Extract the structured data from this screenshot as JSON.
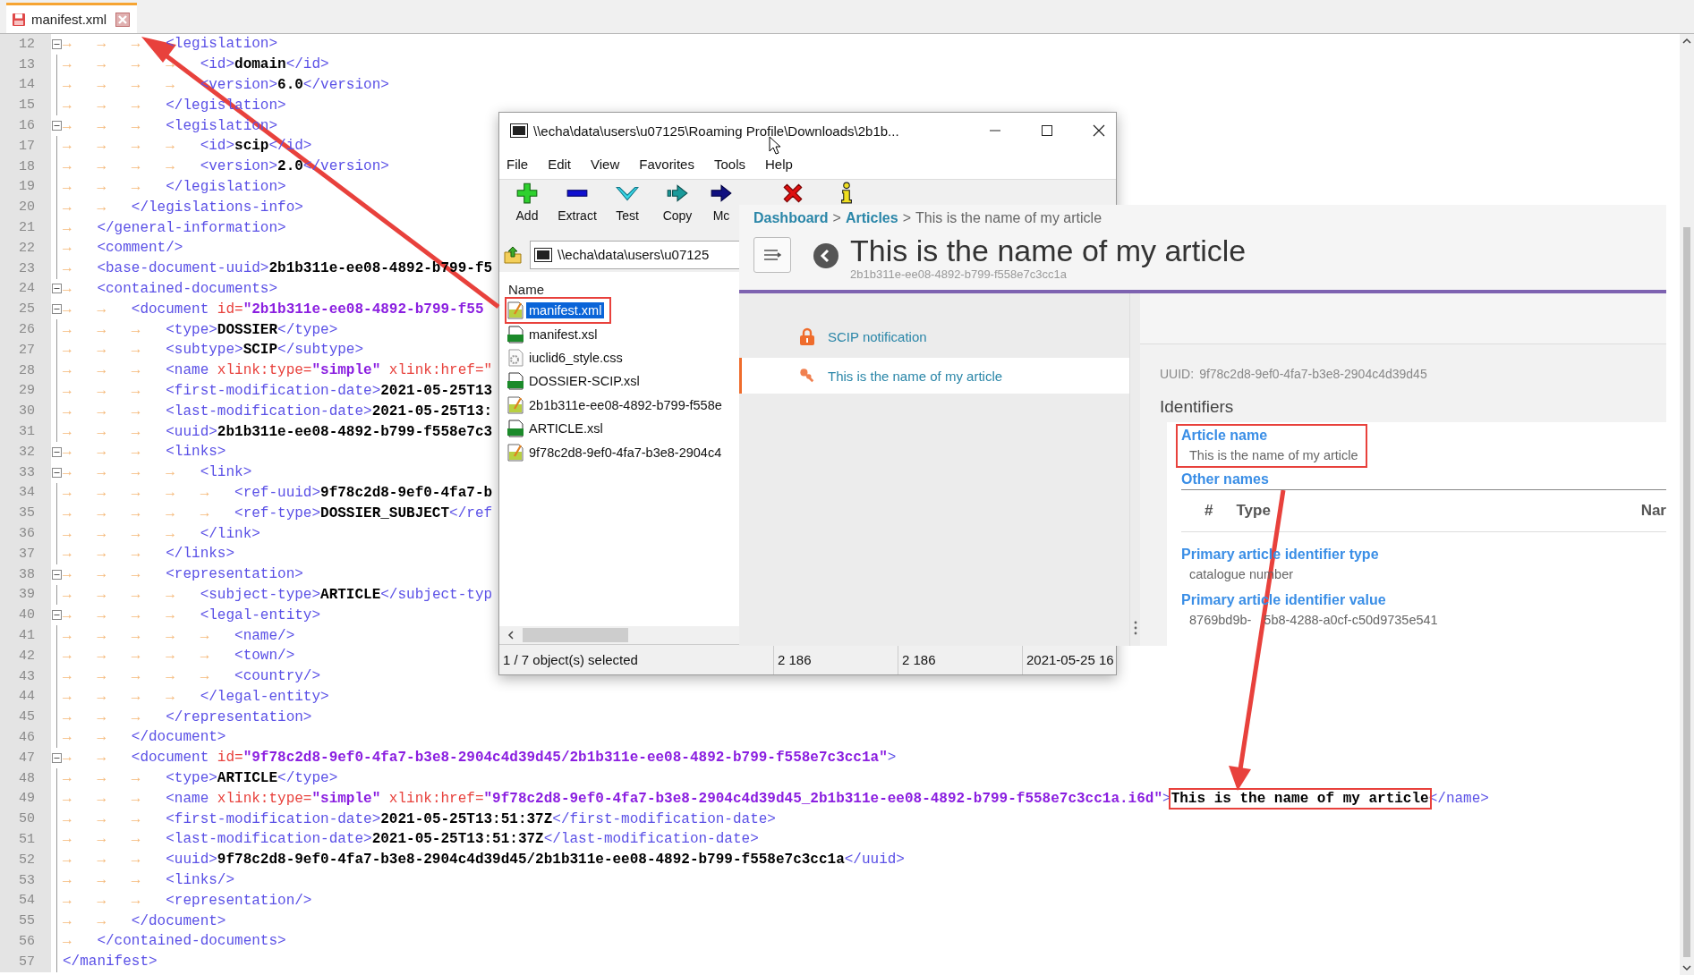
{
  "editor_tab": {
    "title": "manifest.xml",
    "selected": true
  },
  "code_lines": [
    {
      "number": "12",
      "fold_marker": true,
      "tokens": [
        {
          "kind": "tabs",
          "text": "→   →   →   "
        },
        {
          "kind": "tag",
          "text": "<legislation>"
        }
      ]
    },
    {
      "number": "13",
      "fold_marker": false,
      "tokens": [
        {
          "kind": "tabs",
          "text": "→   →   →   →   "
        },
        {
          "kind": "tag",
          "text": "<id>"
        },
        {
          "kind": "text",
          "text": "domain"
        },
        {
          "kind": "tag",
          "text": "</id>"
        }
      ]
    },
    {
      "number": "14",
      "fold_marker": false,
      "tokens": [
        {
          "kind": "tabs",
          "text": "→   →   →   →   "
        },
        {
          "kind": "tag",
          "text": "<version>"
        },
        {
          "kind": "text",
          "text": "6.0"
        },
        {
          "kind": "tag",
          "text": "</version>"
        }
      ]
    },
    {
      "number": "15",
      "fold_marker": false,
      "tokens": [
        {
          "kind": "tabs",
          "text": "→   →   →   "
        },
        {
          "kind": "tag",
          "text": "</legislation>"
        }
      ]
    },
    {
      "number": "16",
      "fold_marker": true,
      "tokens": [
        {
          "kind": "tabs",
          "text": "→   →   →   "
        },
        {
          "kind": "tag",
          "text": "<legislation>"
        }
      ]
    },
    {
      "number": "17",
      "fold_marker": false,
      "tokens": [
        {
          "kind": "tabs",
          "text": "→   →   →   →   "
        },
        {
          "kind": "tag",
          "text": "<id>"
        },
        {
          "kind": "text",
          "text": "scip"
        },
        {
          "kind": "tag",
          "text": "</id>"
        }
      ]
    },
    {
      "number": "18",
      "fold_marker": false,
      "tokens": [
        {
          "kind": "tabs",
          "text": "→   →   →   →   "
        },
        {
          "kind": "tag",
          "text": "<version>"
        },
        {
          "kind": "text",
          "text": "2.0"
        },
        {
          "kind": "tag",
          "text": "</version>"
        }
      ]
    },
    {
      "number": "19",
      "fold_marker": false,
      "tokens": [
        {
          "kind": "tabs",
          "text": "→   →   →   "
        },
        {
          "kind": "tag",
          "text": "</legislation>"
        }
      ]
    },
    {
      "number": "20",
      "fold_marker": false,
      "tokens": [
        {
          "kind": "tabs",
          "text": "→   →   "
        },
        {
          "kind": "tag",
          "text": "</legislations-info>"
        }
      ]
    },
    {
      "number": "21",
      "fold_marker": false,
      "tokens": [
        {
          "kind": "tabs",
          "text": "→   "
        },
        {
          "kind": "tag",
          "text": "</general-information>"
        }
      ]
    },
    {
      "number": "22",
      "fold_marker": false,
      "tokens": [
        {
          "kind": "tabs",
          "text": "→   "
        },
        {
          "kind": "tag",
          "text": "<comment/>"
        }
      ]
    },
    {
      "number": "23",
      "fold_marker": false,
      "tokens": [
        {
          "kind": "tabs",
          "text": "→   "
        },
        {
          "kind": "tag",
          "text": "<base-document-uuid>"
        },
        {
          "kind": "text",
          "text": "2b1b311e-ee08-4892-b799-f5"
        }
      ]
    },
    {
      "number": "24",
      "fold_marker": true,
      "tokens": [
        {
          "kind": "tabs",
          "text": "→   "
        },
        {
          "kind": "tag",
          "text": "<contained-documents>"
        }
      ]
    },
    {
      "number": "25",
      "fold_marker": true,
      "tokens": [
        {
          "kind": "tabs",
          "text": "→   →   "
        },
        {
          "kind": "tag",
          "text": "<document"
        },
        {
          "kind": "attr",
          "text": " id="
        },
        {
          "kind": "value",
          "text": "\"2b1b311e-ee08-4892-b799-f55"
        }
      ]
    },
    {
      "number": "26",
      "fold_marker": false,
      "tokens": [
        {
          "kind": "tabs",
          "text": "→   →   →   "
        },
        {
          "kind": "tag",
          "text": "<type>"
        },
        {
          "kind": "text",
          "text": "DOSSIER"
        },
        {
          "kind": "tag",
          "text": "</type>"
        }
      ]
    },
    {
      "number": "27",
      "fold_marker": false,
      "tokens": [
        {
          "kind": "tabs",
          "text": "→   →   →   "
        },
        {
          "kind": "tag",
          "text": "<subtype>"
        },
        {
          "kind": "text",
          "text": "SCIP"
        },
        {
          "kind": "tag",
          "text": "</subtype>"
        }
      ]
    },
    {
      "number": "28",
      "fold_marker": false,
      "tokens": [
        {
          "kind": "tabs",
          "text": "→   →   →   "
        },
        {
          "kind": "tag",
          "text": "<name"
        },
        {
          "kind": "attr",
          "text": " xlink:type="
        },
        {
          "kind": "value",
          "text": "\"simple\""
        },
        {
          "kind": "attr",
          "text": " xlink:href=\""
        }
      ]
    },
    {
      "number": "29",
      "fold_marker": false,
      "tokens": [
        {
          "kind": "tabs",
          "text": "→   →   →   "
        },
        {
          "kind": "tag",
          "text": "<first-modification-date>"
        },
        {
          "kind": "text",
          "text": "2021-05-25T13"
        }
      ]
    },
    {
      "number": "30",
      "fold_marker": false,
      "tokens": [
        {
          "kind": "tabs",
          "text": "→   →   →   "
        },
        {
          "kind": "tag",
          "text": "<last-modification-date>"
        },
        {
          "kind": "text",
          "text": "2021-05-25T13:"
        }
      ]
    },
    {
      "number": "31",
      "fold_marker": false,
      "tokens": [
        {
          "kind": "tabs",
          "text": "→   →   →   "
        },
        {
          "kind": "tag",
          "text": "<uuid>"
        },
        {
          "kind": "text",
          "text": "2b1b311e-ee08-4892-b799-f558e7c3"
        }
      ]
    },
    {
      "number": "32",
      "fold_marker": true,
      "tokens": [
        {
          "kind": "tabs",
          "text": "→   →   →   "
        },
        {
          "kind": "tag",
          "text": "<links>"
        }
      ]
    },
    {
      "number": "33",
      "fold_marker": true,
      "tokens": [
        {
          "kind": "tabs",
          "text": "→   →   →   →   "
        },
        {
          "kind": "tag",
          "text": "<link>"
        }
      ]
    },
    {
      "number": "34",
      "fold_marker": false,
      "tokens": [
        {
          "kind": "tabs",
          "text": "→   →   →   →   →   "
        },
        {
          "kind": "tag",
          "text": "<ref-uuid>"
        },
        {
          "kind": "text",
          "text": "9f78c2d8-9ef0-4fa7-b"
        }
      ]
    },
    {
      "number": "35",
      "fold_marker": false,
      "tokens": [
        {
          "kind": "tabs",
          "text": "→   →   →   →   →   "
        },
        {
          "kind": "tag",
          "text": "<ref-type>"
        },
        {
          "kind": "text",
          "text": "DOSSIER_SUBJECT"
        },
        {
          "kind": "tag",
          "text": "</ref"
        }
      ]
    },
    {
      "number": "36",
      "fold_marker": false,
      "tokens": [
        {
          "kind": "tabs",
          "text": "→   →   →   →   "
        },
        {
          "kind": "tag",
          "text": "</link>"
        }
      ]
    },
    {
      "number": "37",
      "fold_marker": false,
      "tokens": [
        {
          "kind": "tabs",
          "text": "→   →   →   "
        },
        {
          "kind": "tag",
          "text": "</links>"
        }
      ]
    },
    {
      "number": "38",
      "fold_marker": true,
      "tokens": [
        {
          "kind": "tabs",
          "text": "→   →   →   "
        },
        {
          "kind": "tag",
          "text": "<representation>"
        }
      ]
    },
    {
      "number": "39",
      "fold_marker": false,
      "tokens": [
        {
          "kind": "tabs",
          "text": "→   →   →   →   "
        },
        {
          "kind": "tag",
          "text": "<subject-type>"
        },
        {
          "kind": "text",
          "text": "ARTICLE"
        },
        {
          "kind": "tag",
          "text": "</subject-typ"
        }
      ]
    },
    {
      "number": "40",
      "fold_marker": true,
      "tokens": [
        {
          "kind": "tabs",
          "text": "→   →   →   →   "
        },
        {
          "kind": "tag",
          "text": "<legal-entity>"
        }
      ]
    },
    {
      "number": "41",
      "fold_marker": false,
      "tokens": [
        {
          "kind": "tabs",
          "text": "→   →   →   →   →   "
        },
        {
          "kind": "tag",
          "text": "<name/>"
        }
      ]
    },
    {
      "number": "42",
      "fold_marker": false,
      "tokens": [
        {
          "kind": "tabs",
          "text": "→   →   →   →   →   "
        },
        {
          "kind": "tag",
          "text": "<town/>"
        }
      ]
    },
    {
      "number": "43",
      "fold_marker": false,
      "tokens": [
        {
          "kind": "tabs",
          "text": "→   →   →   →   →   "
        },
        {
          "kind": "tag",
          "text": "<country/>"
        }
      ]
    },
    {
      "number": "44",
      "fold_marker": false,
      "tokens": [
        {
          "kind": "tabs",
          "text": "→   →   →   →   "
        },
        {
          "kind": "tag",
          "text": "</legal-entity>"
        }
      ]
    },
    {
      "number": "45",
      "fold_marker": false,
      "tokens": [
        {
          "kind": "tabs",
          "text": "→   →   →   "
        },
        {
          "kind": "tag",
          "text": "</representation>"
        }
      ]
    },
    {
      "number": "46",
      "fold_marker": false,
      "tokens": [
        {
          "kind": "tabs",
          "text": "→   →   "
        },
        {
          "kind": "tag",
          "text": "</document>"
        }
      ]
    },
    {
      "number": "47",
      "fold_marker": true,
      "tokens": [
        {
          "kind": "tabs",
          "text": "→   →   "
        },
        {
          "kind": "tag",
          "text": "<document"
        },
        {
          "kind": "attr",
          "text": " id="
        },
        {
          "kind": "value",
          "text": "\"9f78c2d8-9ef0-4fa7-b3e8-2904c4d39d45/2b1b311e-ee08-4892-b799-f558e7c3cc1a\""
        },
        {
          "kind": "tag",
          "text": ">"
        }
      ]
    },
    {
      "number": "48",
      "fold_marker": false,
      "tokens": [
        {
          "kind": "tabs",
          "text": "→   →   →   "
        },
        {
          "kind": "tag",
          "text": "<type>"
        },
        {
          "kind": "text",
          "text": "ARTICLE"
        },
        {
          "kind": "tag",
          "text": "</type>"
        }
      ]
    },
    {
      "number": "49",
      "fold_marker": false,
      "tokens": [
        {
          "kind": "tabs",
          "text": "→   →   →   "
        },
        {
          "kind": "tag",
          "text": "<name"
        },
        {
          "kind": "attr",
          "text": " xlink:type="
        },
        {
          "kind": "value",
          "text": "\"simple\""
        },
        {
          "kind": "attr",
          "text": " xlink:href="
        },
        {
          "kind": "value",
          "text": "\"9f78c2d8-9ef0-4fa7-b3e8-2904c4d39d45_2b1b311e-ee08-4892-b799-f558e7c3cc1a.i6d\""
        },
        {
          "kind": "tag",
          "text": ">"
        },
        {
          "kind": "note",
          "text": "This is the name of my article"
        },
        {
          "kind": "tag",
          "text": "</name>"
        }
      ]
    },
    {
      "number": "50",
      "fold_marker": false,
      "tokens": [
        {
          "kind": "tabs",
          "text": "→   →   →   "
        },
        {
          "kind": "tag",
          "text": "<first-modification-date>"
        },
        {
          "kind": "text",
          "text": "2021-05-25T13:51:37Z"
        },
        {
          "kind": "tag",
          "text": "</first-modification-date>"
        }
      ]
    },
    {
      "number": "51",
      "fold_marker": false,
      "tokens": [
        {
          "kind": "tabs",
          "text": "→   →   →   "
        },
        {
          "kind": "tag",
          "text": "<last-modification-date>"
        },
        {
          "kind": "text",
          "text": "2021-05-25T13:51:37Z"
        },
        {
          "kind": "tag",
          "text": "</last-modification-date>"
        }
      ]
    },
    {
      "number": "52",
      "fold_marker": false,
      "tokens": [
        {
          "kind": "tabs",
          "text": "→   →   →   "
        },
        {
          "kind": "tag",
          "text": "<uuid>"
        },
        {
          "kind": "text",
          "text": "9f78c2d8-9ef0-4fa7-b3e8-2904c4d39d45/2b1b311e-ee08-4892-b799-f558e7c3cc1a"
        },
        {
          "kind": "tag",
          "text": "</uuid>"
        }
      ]
    },
    {
      "number": "53",
      "fold_marker": false,
      "tokens": [
        {
          "kind": "tabs",
          "text": "→   →   →   "
        },
        {
          "kind": "tag",
          "text": "<links/>"
        }
      ]
    },
    {
      "number": "54",
      "fold_marker": false,
      "tokens": [
        {
          "kind": "tabs",
          "text": "→   →   →   "
        },
        {
          "kind": "tag",
          "text": "<representation/>"
        }
      ]
    },
    {
      "number": "55",
      "fold_marker": false,
      "tokens": [
        {
          "kind": "tabs",
          "text": "→   →   "
        },
        {
          "kind": "tag",
          "text": "</document>"
        }
      ]
    },
    {
      "number": "56",
      "fold_marker": false,
      "tokens": [
        {
          "kind": "tabs",
          "text": "→   "
        },
        {
          "kind": "tag",
          "text": "</contained-documents>"
        }
      ]
    },
    {
      "number": "57",
      "fold_marker": false,
      "tokens": [
        {
          "kind": "tag",
          "text": "</manifest>"
        }
      ]
    }
  ],
  "archive_window": {
    "title": "\\\\echa\\data\\users\\u07125\\Roaming Profile\\Downloads\\2b1b...",
    "menu": [
      "File",
      "Edit",
      "View",
      "Favorites",
      "Tools",
      "Help"
    ],
    "toolbar": [
      {
        "kind": "add",
        "label": "Add"
      },
      {
        "kind": "extract",
        "label": "Extract"
      },
      {
        "kind": "test",
        "label": "Test"
      },
      {
        "kind": "copy",
        "label": "Copy"
      },
      {
        "kind": "move",
        "label": "Mc"
      },
      {
        "kind": "delete"
      },
      {
        "kind": "info"
      }
    ],
    "address": "\\\\echa\\data\\users\\u07125",
    "column_header": "Name",
    "files": [
      {
        "name": "manifest.xml",
        "kind": "xml",
        "selected": true,
        "annotated": true
      },
      {
        "name": "manifest.xsl",
        "kind": "xsl",
        "selected": false,
        "annotated": false
      },
      {
        "name": "iuclid6_style.css",
        "kind": "css",
        "selected": false,
        "annotated": false
      },
      {
        "name": "DOSSIER-SCIP.xsl",
        "kind": "xsl",
        "selected": false,
        "annotated": false
      },
      {
        "name": "2b1b311e-ee08-4892-b799-f558e",
        "kind": "xml",
        "selected": false,
        "annotated": false
      },
      {
        "name": "ARTICLE.xsl",
        "kind": "xsl",
        "selected": false,
        "annotated": false
      },
      {
        "name": "9f78c2d8-9ef0-4fa7-b3e8-2904c4",
        "kind": "xml",
        "selected": false,
        "annotated": false
      }
    ],
    "status": [
      "1 / 7 object(s) selected",
      "2 186",
      "2 186",
      "2021-05-25 16"
    ]
  },
  "web_page": {
    "breadcrumb": [
      {
        "kind": "link",
        "text": "Dashboard"
      },
      {
        "kind": "separator",
        "text": ">"
      },
      {
        "kind": "link",
        "text": "Articles"
      },
      {
        "kind": "separator",
        "text": ">"
      },
      {
        "kind": "current",
        "text": "This is the name of my article"
      }
    ],
    "title": "This is the name of my article",
    "subtitle": "2b1b311e-ee08-4892-b799-f558e7c3cc1a",
    "nav": [
      {
        "kind": "lock",
        "label": "SCIP notification",
        "selected": false
      },
      {
        "kind": "pin",
        "label": "This is the name of my article",
        "selected": true
      }
    ],
    "uuid_label": "UUID:",
    "uuid_value": "9f78c2d8-9ef0-4fa7-b3e8-2904c4d39d45",
    "section": "Identifiers",
    "fields": [
      {
        "kind": "field",
        "label": "Article name",
        "value_parts": [
          "This is the name of my article"
        ],
        "annotated": true
      },
      {
        "kind": "table",
        "label": "Other names",
        "columns": [
          "#",
          "Type",
          "Nar"
        ]
      },
      {
        "kind": "field",
        "label": "Primary article identifier type",
        "value_parts": [
          "catalogue number"
        ],
        "annotated": false
      },
      {
        "kind": "field",
        "label": "Primary article identifier value",
        "value_parts": [
          "8769bd9b-",
          "5b8-4288-a0cf-c50d9735e541"
        ],
        "annotated": false
      }
    ]
  }
}
